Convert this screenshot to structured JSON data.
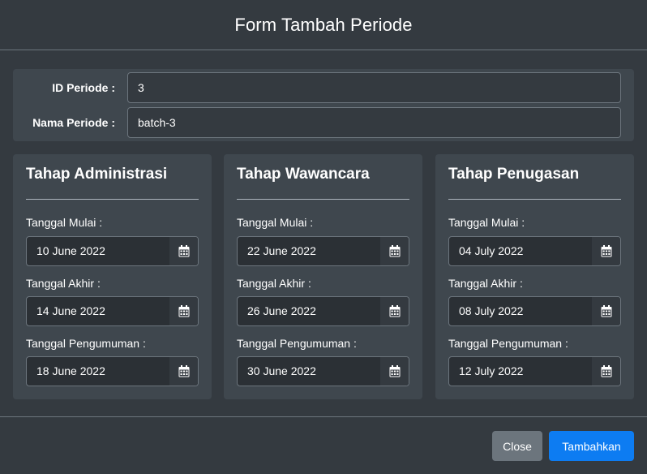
{
  "modal": {
    "title": "Form Tambah Periode"
  },
  "periode": {
    "id_label": "ID Periode :",
    "id_value": "3",
    "name_label": "Nama Periode :",
    "name_value": "batch-3"
  },
  "stages": [
    {
      "title": "Tahap Administrasi",
      "start_label": "Tanggal Mulai :",
      "start": "10 June 2022",
      "end_label": "Tanggal Akhir :",
      "end": "14 June 2022",
      "announce_label": "Tanggal Pengumuman :",
      "announce": "18 June 2022"
    },
    {
      "title": "Tahap Wawancara",
      "start_label": "Tanggal Mulai :",
      "start": "22 June 2022",
      "end_label": "Tanggal Akhir :",
      "end": "26 June 2022",
      "announce_label": "Tanggal Pengumuman :",
      "announce": "30 June 2022"
    },
    {
      "title": "Tahap Penugasan",
      "start_label": "Tanggal Mulai :",
      "start": "04 July 2022",
      "end_label": "Tanggal Akhir :",
      "end": "08 July 2022",
      "announce_label": "Tanggal Pengumuman :",
      "announce": "12 July 2022"
    }
  ],
  "footer": {
    "close_label": "Close",
    "submit_label": "Tambahkan"
  },
  "icons": {
    "date_picker": "calendar-icon"
  },
  "colors": {
    "background": "#343a40",
    "panel": "#3f474e",
    "primary": "#0d7cf2",
    "secondary": "#6c757d"
  }
}
